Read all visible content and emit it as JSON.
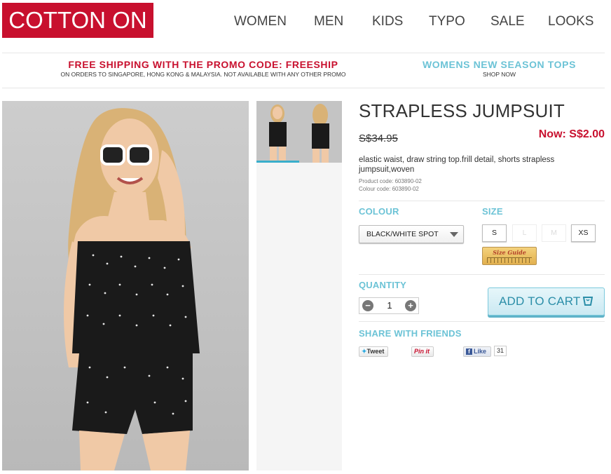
{
  "brand": {
    "logo_text": "COTTON ON",
    "accent_color": "#c8102e",
    "secondary_color": "#6cc3d6"
  },
  "nav": {
    "items": [
      "WOMEN",
      "MEN",
      "KIDS",
      "TYPO",
      "SALE",
      "LOOKS"
    ]
  },
  "promos": [
    {
      "headline": "FREE SHIPPING WITH THE PROMO CODE: FREESHIP",
      "sub": "ON ORDERS TO SINGAPORE, HONG KONG & MALAYSIA. NOT AVAILABLE WITH ANY OTHER PROMO"
    },
    {
      "headline": "WOMENS NEW SEASON TOPS",
      "sub": "SHOP NOW"
    }
  ],
  "product": {
    "title": "STRAPLESS JUMPSUIT",
    "was_price": "S$34.95",
    "now_price": "Now: S$2.00",
    "description": "elastic waist, draw string top.frill detail, shorts strapless jumpsuit,woven",
    "product_code": "Product code: 603890-02",
    "colour_code": "Colour code: 603890-02"
  },
  "options": {
    "colour_label": "COLOUR",
    "colour_selected": "BLACK/WHITE SPOT",
    "size_label": "SIZE",
    "sizes": [
      {
        "label": "S",
        "available": true
      },
      {
        "label": "L",
        "available": false
      },
      {
        "label": "M",
        "available": false
      },
      {
        "label": "XS",
        "available": true
      }
    ],
    "size_guide_label": "Size Guide"
  },
  "purchase": {
    "quantity_label": "QUANTITY",
    "minus": "−",
    "quantity": "1",
    "plus": "+",
    "add_to_cart": "ADD TO CART"
  },
  "share": {
    "label": "SHARE WITH FRIENDS",
    "tweet": "Tweet",
    "pin": "Pin it",
    "like": "Like",
    "like_count": "31"
  },
  "icons": [
    "shopping-bag-icon",
    "facebook-icon",
    "twitter-bird-icon",
    "chevron-down-icon"
  ]
}
